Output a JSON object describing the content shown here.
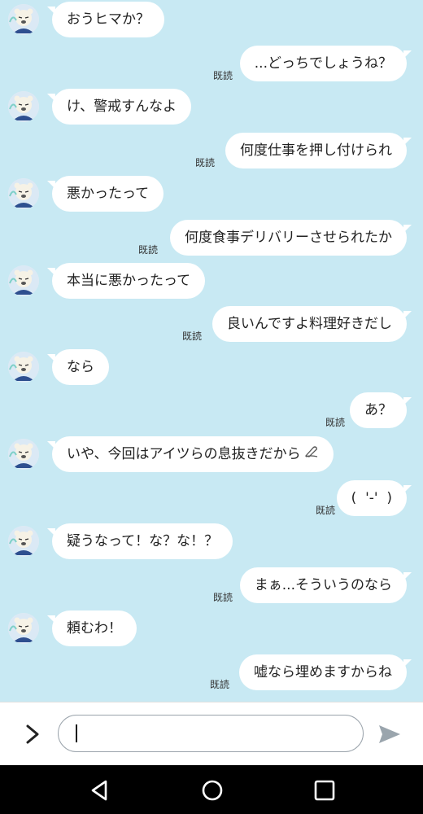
{
  "conversation": {
    "messages": [
      {
        "side": "in",
        "text": "おうヒマか？"
      },
      {
        "side": "out",
        "text": "...どっちでしょうね？",
        "read": "既読"
      },
      {
        "side": "in",
        "text": "け、警戒すんなよ"
      },
      {
        "side": "out",
        "text": "何度仕事を押し付けられ",
        "read": "既読"
      },
      {
        "side": "in",
        "text": "悪かったって"
      },
      {
        "side": "out",
        "text": "何度食事デリバリーさせられたか",
        "read": "既読"
      },
      {
        "side": "in",
        "text": "本当に悪かったって"
      },
      {
        "side": "out",
        "text": "良いんですよ料理好きだし",
        "read": "既読"
      },
      {
        "side": "in",
        "text": "なら"
      },
      {
        "side": "out",
        "text": "あ？",
        "read": "既読"
      },
      {
        "side": "in",
        "text": "いや、今回はアイツらの息抜きだから",
        "emoji_icon": "pencil-emoji-icon"
      },
      {
        "side": "out",
        "text": "(  '-'  )",
        "read": "既読"
      },
      {
        "side": "in",
        "text": "疑うなって！な？な！？"
      },
      {
        "side": "out",
        "text": "まぁ...そういうのなら",
        "read": "既読"
      },
      {
        "side": "in",
        "text": "頼むわ！"
      },
      {
        "side": "out",
        "text": "嘘なら埋めますからね",
        "read": "既読"
      }
    ]
  },
  "composer": {
    "input_value": "",
    "expand_icon": "chevron-right-icon",
    "send_icon": "send-icon"
  },
  "navigation": {
    "back_icon": "triangle-back-icon",
    "home_icon": "circle-home-icon",
    "recents_icon": "square-recents-icon"
  },
  "colors": {
    "chat_background": "#c8e9f3",
    "bubble": "#ffffff",
    "nav_bar": "#000000"
  }
}
